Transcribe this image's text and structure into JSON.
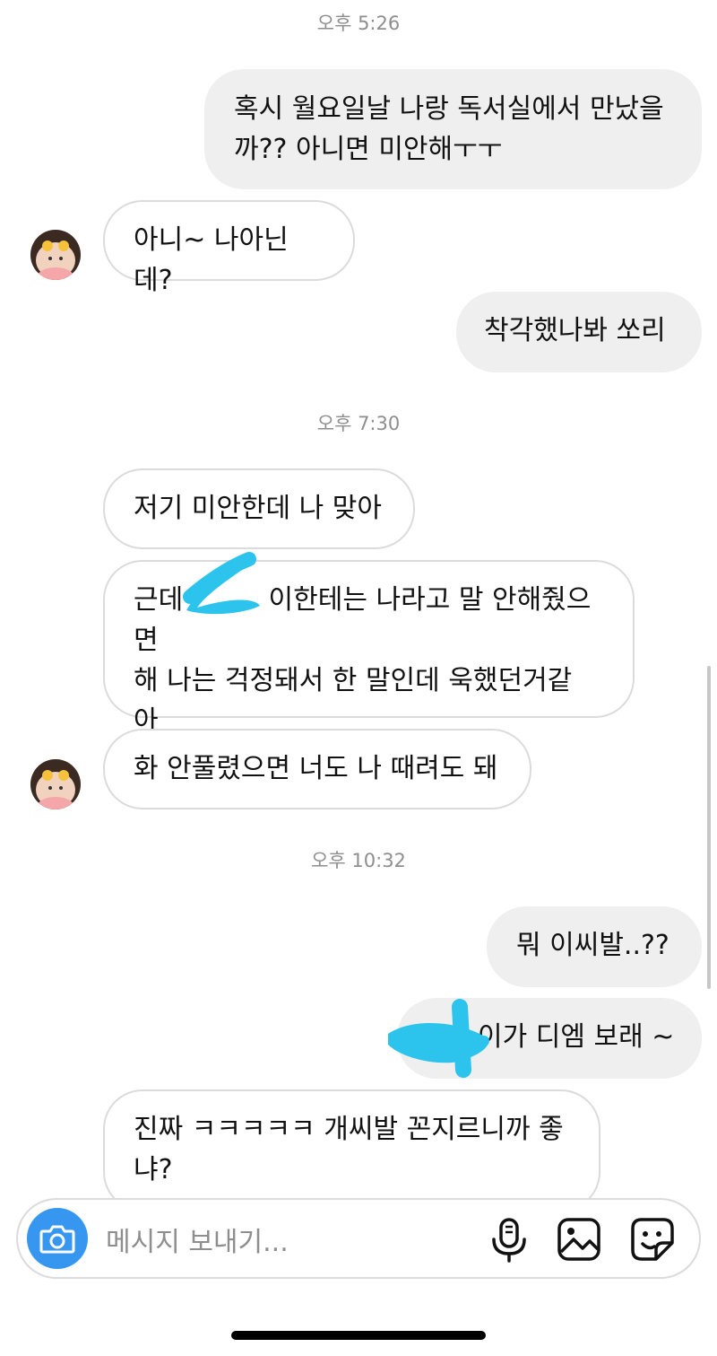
{
  "timestamps": [
    "오후 5:26",
    "오후 7:30",
    "오후 10:32"
  ],
  "messages": [
    {
      "dir": "out",
      "text": "혹시 월요일날 나랑 독서실에서 만났을\n까?? 아니면 미안해ㅜㅜ"
    },
    {
      "dir": "in",
      "text": "아니~ 나아닌데?"
    },
    {
      "dir": "out",
      "text": "착각했나봐 쏘리"
    },
    {
      "dir": "in",
      "text": "저기 미안한데 나 맞아"
    },
    {
      "dir": "in",
      "text": "근데          이한테는 나라고 말 안해줬으면\n해 나는 걱정돼서 한 말인데 욱했던거같\n아"
    },
    {
      "dir": "in",
      "text": "화 안풀렸으면 너도 나 때려도 돼"
    },
    {
      "dir": "out",
      "text": "뭐 이씨발..??"
    },
    {
      "dir": "out",
      "text": "이가 디엠 보래 ~"
    },
    {
      "dir": "in",
      "text": "진짜 ㅋㅋㅋㅋㅋ 개씨발 꼰지르니까 좋\n냐?"
    }
  ],
  "composer": {
    "placeholder": "메시지 보내기..."
  },
  "colors": {
    "accent": "#3797f0",
    "redaction": "#2cc4ec",
    "outgoing_bubble": "#efefef",
    "incoming_border": "#dbdbdb"
  },
  "icons": [
    "camera-icon",
    "microphone-icon",
    "gallery-icon",
    "sticker-icon"
  ]
}
